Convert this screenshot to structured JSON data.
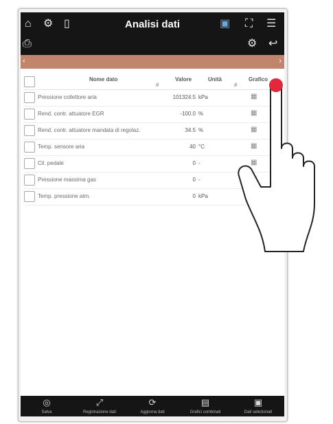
{
  "topbar": {
    "title": "Analisi dati",
    "left_icons": [
      "home-icon",
      "engine-icon",
      "battery-icon"
    ],
    "right_icons": [
      "sd-card-icon",
      "fullscreen-icon",
      "menu-icon"
    ],
    "row2_left_icon": "print-icon",
    "row2_right_icons": [
      "settings-icon",
      "back-icon"
    ]
  },
  "search": {
    "placeholder": ""
  },
  "table": {
    "headers": {
      "name": "Nome dato",
      "value": "Valore",
      "unit": "Unità",
      "graph": "Grafico"
    },
    "rows": [
      {
        "name": "Pressione collettore aria",
        "value": "101324.5",
        "unit": "kPa"
      },
      {
        "name": "Rend. contr. attuatore EGR",
        "value": "-100.0",
        "unit": "%"
      },
      {
        "name": "Rend. contr. attuatore mandata di regolaz.",
        "value": "34.5",
        "unit": "%"
      },
      {
        "name": "Temp. sensore aria",
        "value": "40",
        "unit": "°C"
      },
      {
        "name": "Cil. pedale",
        "value": "0",
        "unit": "-"
      },
      {
        "name": "Pressione massima gas",
        "value": "0",
        "unit": "-"
      },
      {
        "name": "Temp. pressione atm.",
        "value": "0",
        "unit": "kPa"
      }
    ]
  },
  "bottombar": {
    "items": [
      {
        "label": "Salva",
        "icon": "record-icon"
      },
      {
        "label": "Registrazione dati",
        "icon": "expand-icon"
      },
      {
        "label": "Aggiorna dati",
        "icon": "refresh-icon"
      },
      {
        "label": "Grafici combinati",
        "icon": "chart-icon"
      },
      {
        "label": "Dati selezionati",
        "icon": "calendar-icon"
      }
    ]
  },
  "colors": {
    "topbar": "#151515",
    "search_bar": "#c0856a",
    "touch_indicator": "#e2283c"
  }
}
